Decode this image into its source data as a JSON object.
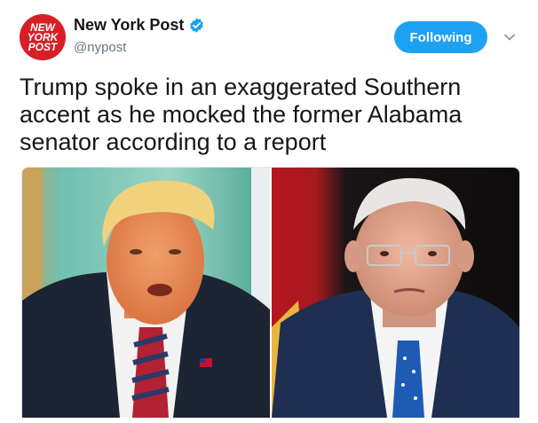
{
  "account": {
    "display_name": "New York Post",
    "handle": "@nypost",
    "avatar_text": [
      "NEW",
      "YORK",
      "POST"
    ],
    "verified": true,
    "follow_label": "Following"
  },
  "tweet": {
    "text": "Trump spoke in an exaggerated Southern accent as he mocked the former Alabama senator according to a report"
  },
  "media": {
    "images": [
      {
        "icon": "photo-person-left"
      },
      {
        "icon": "photo-person-right"
      }
    ]
  },
  "colors": {
    "brand_red": "#d81f26",
    "accent_blue": "#1da1f2",
    "text": "#14171a",
    "muted": "#657786"
  }
}
